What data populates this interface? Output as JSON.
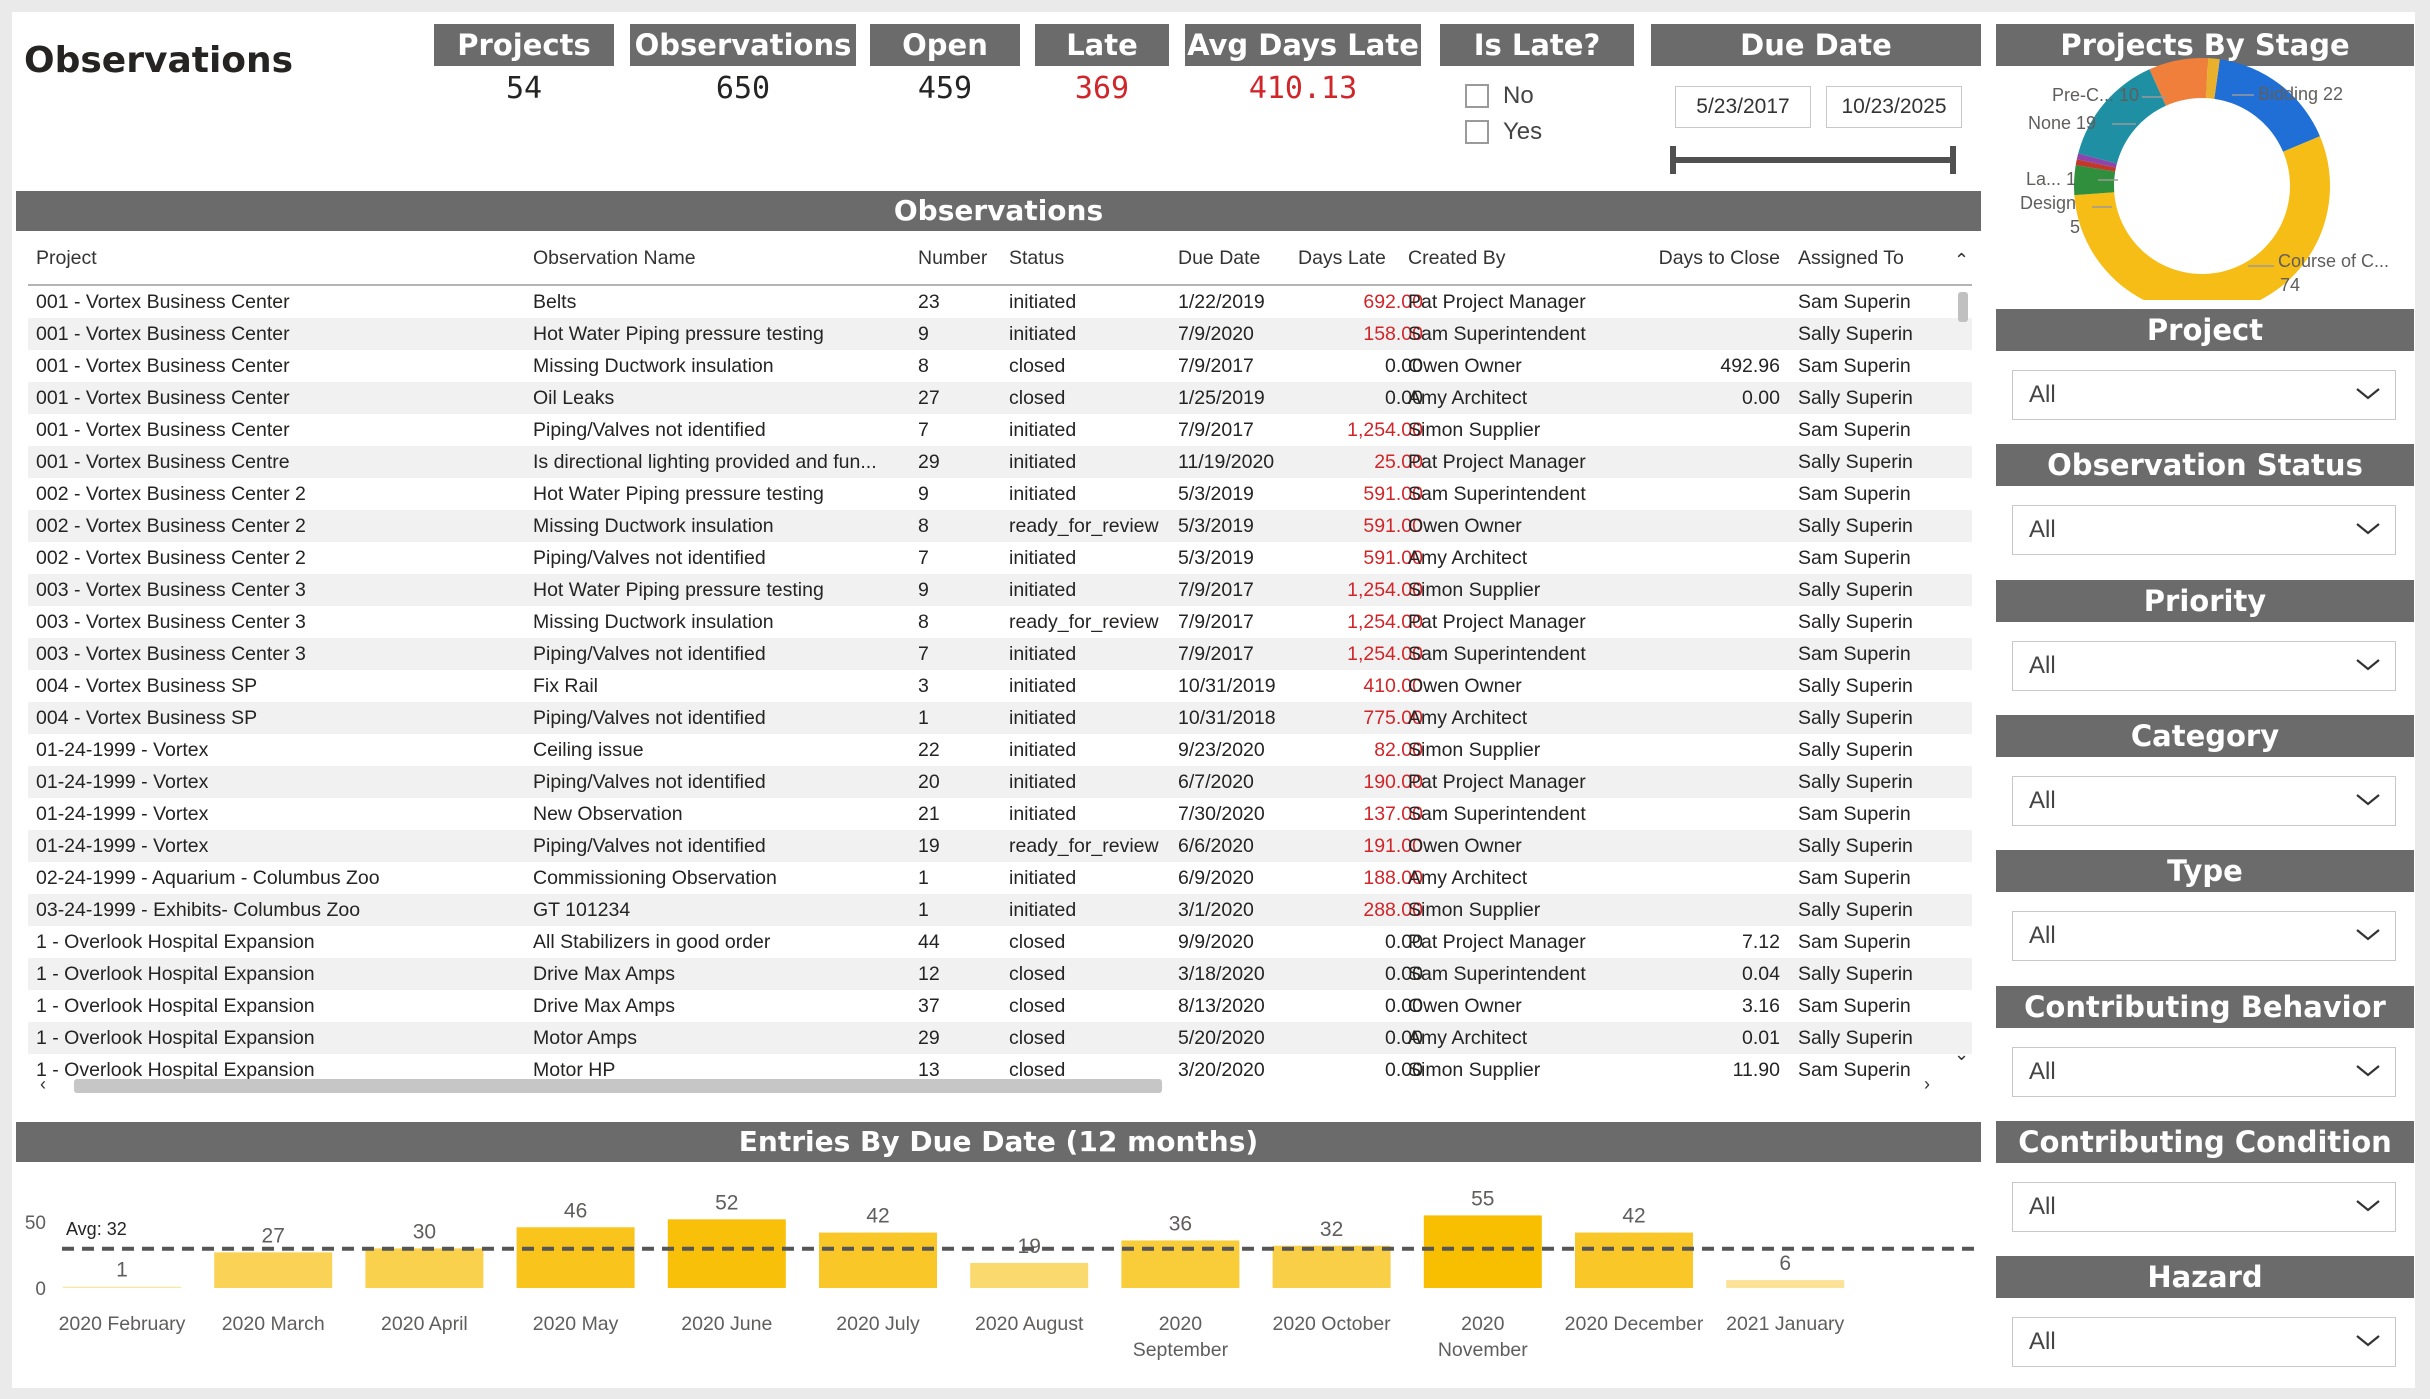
{
  "page": {
    "title": "Observations"
  },
  "kpis": [
    {
      "label": "Projects",
      "value": "54",
      "alert": false
    },
    {
      "label": "Observations",
      "value": "650",
      "alert": false
    },
    {
      "label": "Open",
      "value": "459",
      "alert": false
    },
    {
      "label": "Late",
      "value": "369",
      "alert": true
    },
    {
      "label": "Avg Days Late",
      "value": "410.13",
      "alert": true
    }
  ],
  "is_late": {
    "title": "Is Late?",
    "options": [
      "No",
      "Yes"
    ]
  },
  "due_date": {
    "title": "Due Date",
    "start": "5/23/2017",
    "end": "10/23/2025"
  },
  "table": {
    "title": "Observations",
    "columns": [
      "Project",
      "Observation Name",
      "Number",
      "Status",
      "Due Date",
      "Days Late",
      "Created By",
      "Days to Close",
      "Assigned To"
    ],
    "rows": [
      [
        "001 - Vortex Business Center",
        "Belts",
        "23",
        "initiated",
        "1/22/2019",
        "692.00",
        "Pat Project Manager",
        "",
        "Sam Superin"
      ],
      [
        "001 - Vortex Business Center",
        "Hot Water Piping pressure testing",
        "9",
        "initiated",
        "7/9/2020",
        "158.00",
        "Sam Superintendent",
        "",
        "Sally Superin"
      ],
      [
        "001 - Vortex Business Center",
        "Missing Ductwork insulation",
        "8",
        "closed",
        "7/9/2017",
        "0.00",
        "Owen Owner",
        "492.96",
        "Sam Superin"
      ],
      [
        "001 - Vortex Business Center",
        "Oil Leaks",
        "27",
        "closed",
        "1/25/2019",
        "0.00",
        "Amy Architect",
        "0.00",
        "Sally Superin"
      ],
      [
        "001 - Vortex Business Center",
        "Piping/Valves not identified",
        "7",
        "initiated",
        "7/9/2017",
        "1,254.00",
        "Simon Supplier",
        "",
        "Sam Superin"
      ],
      [
        "001 - Vortex Business Centre",
        "Is directional lighting provided and fun...",
        "29",
        "initiated",
        "11/19/2020",
        "25.00",
        "Pat Project Manager",
        "",
        "Sally Superin"
      ],
      [
        "002 - Vortex Business Center 2",
        "Hot Water Piping pressure testing",
        "9",
        "initiated",
        "5/3/2019",
        "591.00",
        "Sam Superintendent",
        "",
        "Sam Superin"
      ],
      [
        "002 - Vortex Business Center 2",
        "Missing Ductwork insulation",
        "8",
        "ready_for_review",
        "5/3/2019",
        "591.00",
        "Owen Owner",
        "",
        "Sally Superin"
      ],
      [
        "002 - Vortex Business Center 2",
        "Piping/Valves not identified",
        "7",
        "initiated",
        "5/3/2019",
        "591.00",
        "Amy Architect",
        "",
        "Sam Superin"
      ],
      [
        "003 - Vortex Business Center 3",
        "Hot Water Piping pressure testing",
        "9",
        "initiated",
        "7/9/2017",
        "1,254.00",
        "Simon Supplier",
        "",
        "Sally Superin"
      ],
      [
        "003 - Vortex Business Center 3",
        "Missing Ductwork insulation",
        "8",
        "ready_for_review",
        "7/9/2017",
        "1,254.00",
        "Pat Project Manager",
        "",
        "Sally Superin"
      ],
      [
        "003 - Vortex Business Center 3",
        "Piping/Valves not identified",
        "7",
        "initiated",
        "7/9/2017",
        "1,254.00",
        "Sam Superintendent",
        "",
        "Sam Superin"
      ],
      [
        "004 - Vortex Business SP",
        "Fix Rail",
        "3",
        "initiated",
        "10/31/2019",
        "410.00",
        "Owen Owner",
        "",
        "Sally Superin"
      ],
      [
        "004 - Vortex Business SP",
        "Piping/Valves not identified",
        "1",
        "initiated",
        "10/31/2018",
        "775.00",
        "Amy Architect",
        "",
        "Sally Superin"
      ],
      [
        "01-24-1999 - Vortex",
        "Ceiling issue",
        "22",
        "initiated",
        "9/23/2020",
        "82.00",
        "Simon Supplier",
        "",
        "Sally Superin"
      ],
      [
        "01-24-1999 - Vortex",
        "Piping/Valves not identified",
        "20",
        "initiated",
        "6/7/2020",
        "190.00",
        "Pat Project Manager",
        "",
        "Sally Superin"
      ],
      [
        "01-24-1999 - Vortex",
        "New Observation",
        "21",
        "initiated",
        "7/30/2020",
        "137.00",
        "Sam Superintendent",
        "",
        "Sam Superin"
      ],
      [
        "01-24-1999 - Vortex",
        "Piping/Valves not identified",
        "19",
        "ready_for_review",
        "6/6/2020",
        "191.00",
        "Owen Owner",
        "",
        "Sally Superin"
      ],
      [
        "02-24-1999 - Aquarium - Columbus Zoo",
        "Commissioning Observation",
        "1",
        "initiated",
        "6/9/2020",
        "188.00",
        "Amy Architect",
        "",
        "Sam Superin"
      ],
      [
        "03-24-1999 - Exhibits- Columbus Zoo",
        "GT 101234",
        "1",
        "initiated",
        "3/1/2020",
        "288.00",
        "Simon Supplier",
        "",
        "Sally Superin"
      ],
      [
        "1 - Overlook Hospital Expansion",
        "All Stabilizers in good order",
        "44",
        "closed",
        "9/9/2020",
        "0.00",
        "Pat Project Manager",
        "7.12",
        "Sam Superin"
      ],
      [
        "1 - Overlook Hospital Expansion",
        "Drive Max Amps",
        "12",
        "closed",
        "3/18/2020",
        "0.00",
        "Sam Superintendent",
        "0.04",
        "Sally Superin"
      ],
      [
        "1 - Overlook Hospital Expansion",
        "Drive Max Amps",
        "37",
        "closed",
        "8/13/2020",
        "0.00",
        "Owen Owner",
        "3.16",
        "Sam Superin"
      ],
      [
        "1 - Overlook Hospital Expansion",
        "Motor Amps",
        "29",
        "closed",
        "5/20/2020",
        "0.00",
        "Amy Architect",
        "0.01",
        "Sally Superin"
      ],
      [
        "1 - Overlook Hospital Expansion",
        "Motor HP",
        "13",
        "closed",
        "3/20/2020",
        "0.00",
        "Simon Supplier",
        "11.90",
        "Sam Superin"
      ]
    ]
  },
  "entries_chart": {
    "title": "Entries By Due Date (12 months)",
    "avg_label": "Avg: 32"
  },
  "donut": {
    "title": "Projects By Stage",
    "slices": [
      {
        "label": "Bidding",
        "value": 22,
        "color": "#1f6fd6"
      },
      {
        "label": "Course of C...",
        "value": 74,
        "color": "#f6bd16"
      },
      {
        "label": "Design",
        "value": 5,
        "color": "#2f8f3d"
      },
      {
        "label": "La...",
        "value": 1,
        "color": "#c0392b"
      },
      {
        "label": "None",
        "value": 19,
        "color": "#1f8fa3"
      },
      {
        "label": "Pre-C...",
        "value": 10,
        "color": "#f07f3c"
      }
    ],
    "extra_slice_colors": [
      "#e8b02c",
      "#8e44ad"
    ]
  },
  "slicers": [
    {
      "title": "Project",
      "value": "All"
    },
    {
      "title": "Observation Status",
      "value": "All"
    },
    {
      "title": "Priority",
      "value": "All"
    },
    {
      "title": "Category",
      "value": "All"
    },
    {
      "title": "Type",
      "value": "All"
    },
    {
      "title": "Contributing Behavior",
      "value": "All"
    },
    {
      "title": "Contributing Condition",
      "value": "All"
    },
    {
      "title": "Hazard",
      "value": "All"
    }
  ],
  "chart_data": {
    "type": "bar",
    "title": "Entries By Due Date (12 months)",
    "categories": [
      "2020 February",
      "2020 March",
      "2020 April",
      "2020 May",
      "2020 June",
      "2020 July",
      "2020 August",
      "2020 September",
      "2020 October",
      "2020 November",
      "2020 December",
      "2021 January"
    ],
    "category_lines": [
      [
        "2020 February"
      ],
      [
        "2020 March"
      ],
      [
        "2020 April"
      ],
      [
        "2020 May"
      ],
      [
        "2020 June"
      ],
      [
        "2020 July"
      ],
      [
        "2020 August"
      ],
      [
        "2020",
        "September"
      ],
      [
        "2020 October"
      ],
      [
        "2020",
        "November"
      ],
      [
        "2020 December"
      ],
      [
        "2021 January"
      ]
    ],
    "values": [
      1,
      27,
      30,
      46,
      52,
      42,
      19,
      36,
      32,
      55,
      42,
      6
    ],
    "average": 32,
    "yticks": [
      0,
      50
    ],
    "ylim": [
      0,
      55
    ],
    "grid": false,
    "bar_color_scale": [
      "#fbe6a6",
      "#f8be00"
    ]
  }
}
